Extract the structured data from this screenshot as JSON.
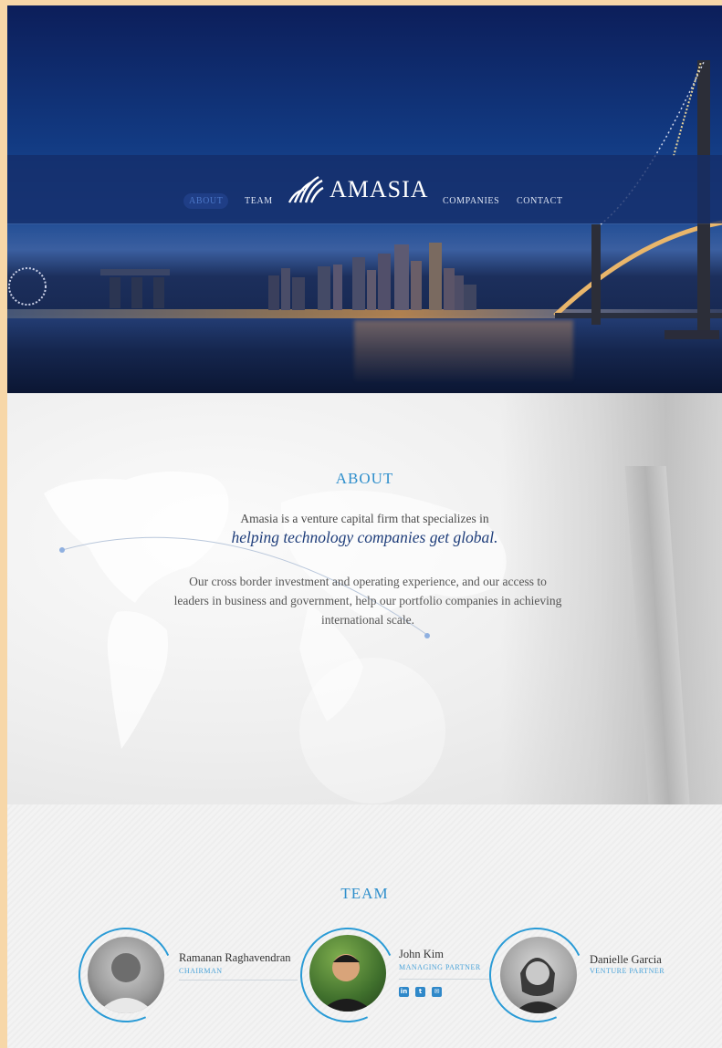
{
  "nav": {
    "items": [
      {
        "label": "ABOUT",
        "active": true
      },
      {
        "label": "TEAM",
        "active": false
      },
      {
        "label": "COMPANIES",
        "active": false
      },
      {
        "label": "CONTACT",
        "active": false
      }
    ],
    "logo_text": "AMASIA"
  },
  "about": {
    "title": "ABOUT",
    "lead": "Amasia is a venture capital firm that specializes in",
    "highlight": "helping technology companies get global.",
    "body": "Our cross border investment and operating experience, and our access to leaders in business and government, help our portfolio companies in achieving international scale."
  },
  "team": {
    "title": "TEAM",
    "members": [
      {
        "name": "Ramanan Raghavendran",
        "role": "CHAIRMAN"
      },
      {
        "name": "John Kim",
        "role": "MANAGING PARTNER",
        "social": [
          "linkedin-icon",
          "twitter-icon",
          "email-icon"
        ]
      },
      {
        "name": "Danielle Garcia",
        "role": "VENTURE PARTNER"
      }
    ]
  },
  "colors": {
    "accent": "#2f8fcc",
    "nav_bg": "#142d69",
    "highlight_text": "#1e3d7a"
  }
}
